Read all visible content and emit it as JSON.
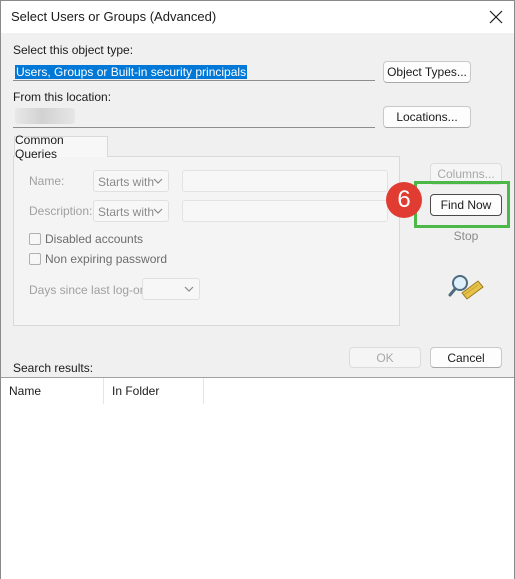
{
  "window": {
    "title": "Select Users or Groups (Advanced)"
  },
  "object_type": {
    "label": "Select this object type:",
    "value": "Users, Groups or Built-in security principals",
    "button": "Object Types..."
  },
  "location": {
    "label": "From this location:",
    "value": "",
    "button": "Locations..."
  },
  "tabs": [
    {
      "label": "Common Queries"
    }
  ],
  "queries": {
    "name_label": "Name:",
    "name_mode": "Starts with",
    "description_label": "Description:",
    "description_mode": "Starts with",
    "disabled_accounts": "Disabled accounts",
    "non_expiring_password": "Non expiring password",
    "days_label": "Days since last log-on:"
  },
  "side_buttons": {
    "columns": "Columns...",
    "find_now": "Find Now",
    "stop": "Stop"
  },
  "annotation": {
    "step": "6",
    "color": "#4cb847",
    "badge_color": "#e03c31"
  },
  "footer": {
    "ok": "OK",
    "cancel": "Cancel"
  },
  "results": {
    "label": "Search results:",
    "columns": [
      "Name",
      "In Folder"
    ]
  },
  "icons": {
    "search": "search-flashlight-icon",
    "close": "close-icon"
  }
}
